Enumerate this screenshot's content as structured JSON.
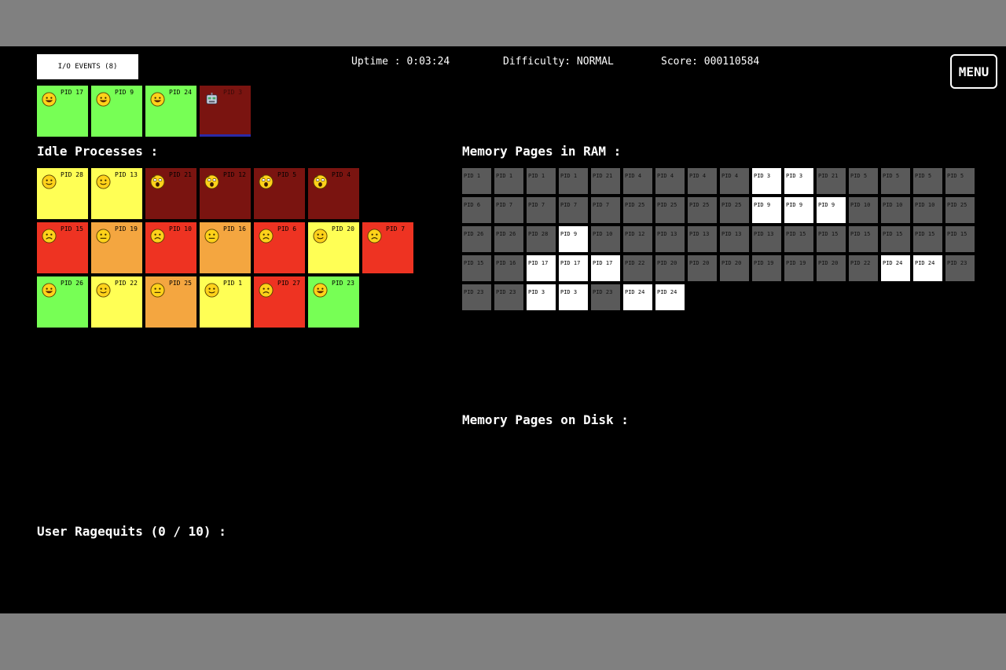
{
  "hud": {
    "io_events_label": "I/O EVENTS (8)",
    "uptime": "Uptime : 0:03:24",
    "difficulty": "Difficulty: NORMAL",
    "score": "Score: 000110584",
    "menu_label": "MENU"
  },
  "cpu_processes": [
    {
      "label": "PID 17",
      "color": "#77ff55",
      "mood": "happy"
    },
    {
      "label": "PID 9",
      "color": "#77ff55",
      "mood": "happy"
    },
    {
      "label": "PID 24",
      "color": "#77ff55",
      "mood": "happy"
    },
    {
      "label": "PID 3",
      "color": "#7a1410",
      "mood": "robot"
    }
  ],
  "idle_heading": "Idle Processes :",
  "idle_processes": [
    [
      {
        "label": "PID 28",
        "color": "#ffff55",
        "mood": "smile"
      },
      {
        "label": "PID 13",
        "color": "#ffff55",
        "mood": "smile"
      },
      {
        "label": "PID 21",
        "color": "#7a1410",
        "mood": "scream"
      },
      {
        "label": "PID 12",
        "color": "#7a1410",
        "mood": "scream"
      },
      {
        "label": "PID 5",
        "color": "#7a1410",
        "mood": "scream"
      },
      {
        "label": "PID 4",
        "color": "#7a1410",
        "mood": "scream"
      }
    ],
    [
      {
        "label": "PID 15",
        "color": "#ee3322",
        "mood": "sad"
      },
      {
        "label": "PID 19",
        "color": "#f4a640",
        "mood": "neutral"
      },
      {
        "label": "PID 10",
        "color": "#ee3322",
        "mood": "sad"
      },
      {
        "label": "PID 16",
        "color": "#f4a640",
        "mood": "neutral"
      },
      {
        "label": "PID 6",
        "color": "#ee3322",
        "mood": "sad"
      },
      {
        "label": "PID 20",
        "color": "#ffff55",
        "mood": "smile"
      },
      {
        "label": "PID 7",
        "color": "#ee3322",
        "mood": "sad"
      }
    ],
    [
      {
        "label": "PID 26",
        "color": "#77ff55",
        "mood": "happy"
      },
      {
        "label": "PID 22",
        "color": "#ffff55",
        "mood": "smile"
      },
      {
        "label": "PID 25",
        "color": "#f4a640",
        "mood": "neutral"
      },
      {
        "label": "PID 1",
        "color": "#ffff55",
        "mood": "smile"
      },
      {
        "label": "PID 27",
        "color": "#ee3322",
        "mood": "sad"
      },
      {
        "label": "PID 23",
        "color": "#77ff55",
        "mood": "happy"
      }
    ]
  ],
  "ram_heading": "Memory Pages in RAM :",
  "ram_pages": [
    {
      "label": "PID 1",
      "active": false
    },
    {
      "label": "PID 1",
      "active": false
    },
    {
      "label": "PID 1",
      "active": false
    },
    {
      "label": "PID 1",
      "active": false
    },
    {
      "label": "PID 21",
      "active": false
    },
    {
      "label": "PID 4",
      "active": false
    },
    {
      "label": "PID 4",
      "active": false
    },
    {
      "label": "PID 4",
      "active": false
    },
    {
      "label": "PID 4",
      "active": false
    },
    {
      "label": "PID 3",
      "active": true
    },
    {
      "label": "PID 3",
      "active": true
    },
    {
      "label": "PID 21",
      "active": false
    },
    {
      "label": "PID 5",
      "active": false
    },
    {
      "label": "PID 5",
      "active": false
    },
    {
      "label": "PID 5",
      "active": false
    },
    {
      "label": "PID 5",
      "active": false
    },
    {
      "label": "PID 6",
      "active": false
    },
    {
      "label": "PID 7",
      "active": false
    },
    {
      "label": "PID 7",
      "active": false
    },
    {
      "label": "PID 7",
      "active": false
    },
    {
      "label": "PID 7",
      "active": false
    },
    {
      "label": "PID 25",
      "active": false
    },
    {
      "label": "PID 25",
      "active": false
    },
    {
      "label": "PID 25",
      "active": false
    },
    {
      "label": "PID 25",
      "active": false
    },
    {
      "label": "PID 9",
      "active": true
    },
    {
      "label": "PID 9",
      "active": true
    },
    {
      "label": "PID 9",
      "active": true
    },
    {
      "label": "PID 10",
      "active": false
    },
    {
      "label": "PID 10",
      "active": false
    },
    {
      "label": "PID 10",
      "active": false
    },
    {
      "label": "PID 25",
      "active": false
    },
    {
      "label": "PID 26",
      "active": false
    },
    {
      "label": "PID 26",
      "active": false
    },
    {
      "label": "PID 28",
      "active": false
    },
    {
      "label": "PID 9",
      "active": true
    },
    {
      "label": "PID 10",
      "active": false
    },
    {
      "label": "PID 12",
      "active": false
    },
    {
      "label": "PID 13",
      "active": false
    },
    {
      "label": "PID 13",
      "active": false
    },
    {
      "label": "PID 13",
      "active": false
    },
    {
      "label": "PID 13",
      "active": false
    },
    {
      "label": "PID 15",
      "active": false
    },
    {
      "label": "PID 15",
      "active": false
    },
    {
      "label": "PID 15",
      "active": false
    },
    {
      "label": "PID 15",
      "active": false
    },
    {
      "label": "PID 15",
      "active": false
    },
    {
      "label": "PID 15",
      "active": false
    },
    {
      "label": "PID 15",
      "active": false
    },
    {
      "label": "PID 16",
      "active": false
    },
    {
      "label": "PID 17",
      "active": true
    },
    {
      "label": "PID 17",
      "active": true
    },
    {
      "label": "PID 17",
      "active": true
    },
    {
      "label": "PID 22",
      "active": false
    },
    {
      "label": "PID 20",
      "active": false
    },
    {
      "label": "PID 20",
      "active": false
    },
    {
      "label": "PID 20",
      "active": false
    },
    {
      "label": "PID 19",
      "active": false
    },
    {
      "label": "PID 19",
      "active": false
    },
    {
      "label": "PID 20",
      "active": false
    },
    {
      "label": "PID 22",
      "active": false
    },
    {
      "label": "PID 24",
      "active": true
    },
    {
      "label": "PID 24",
      "active": true
    },
    {
      "label": "PID 23",
      "active": false
    },
    {
      "label": "PID 23",
      "active": false
    },
    {
      "label": "PID 23",
      "active": false
    },
    {
      "label": "PID 3",
      "active": true
    },
    {
      "label": "PID 3",
      "active": true
    },
    {
      "label": "PID 23",
      "active": false
    },
    {
      "label": "PID 24",
      "active": true
    },
    {
      "label": "PID 24",
      "active": true
    }
  ],
  "disk_heading": "Memory Pages on Disk :",
  "ragequits_heading": "User Ragequits (0 / 10) :"
}
